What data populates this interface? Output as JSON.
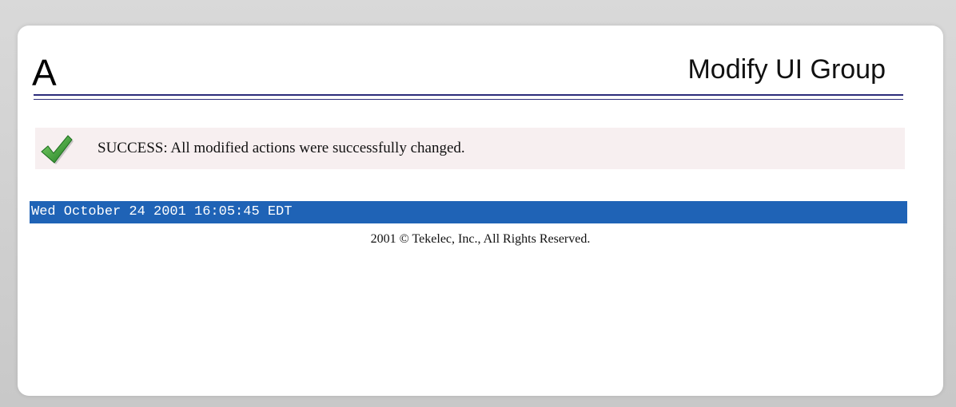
{
  "header": {
    "letter": "A",
    "title": "Modify UI Group"
  },
  "message": {
    "icon": "check-icon",
    "text": "SUCCESS: All modified actions were successfully changed."
  },
  "status_bar": {
    "datetime": "Wed October 24 2001 16:05:45 EDT"
  },
  "footer": {
    "copyright": "2001 © Tekelec, Inc., All Rights Reserved."
  },
  "colors": {
    "date_bar": "#1f63b6",
    "rule": "#2c2c7a",
    "check": "#3a9a2f"
  }
}
